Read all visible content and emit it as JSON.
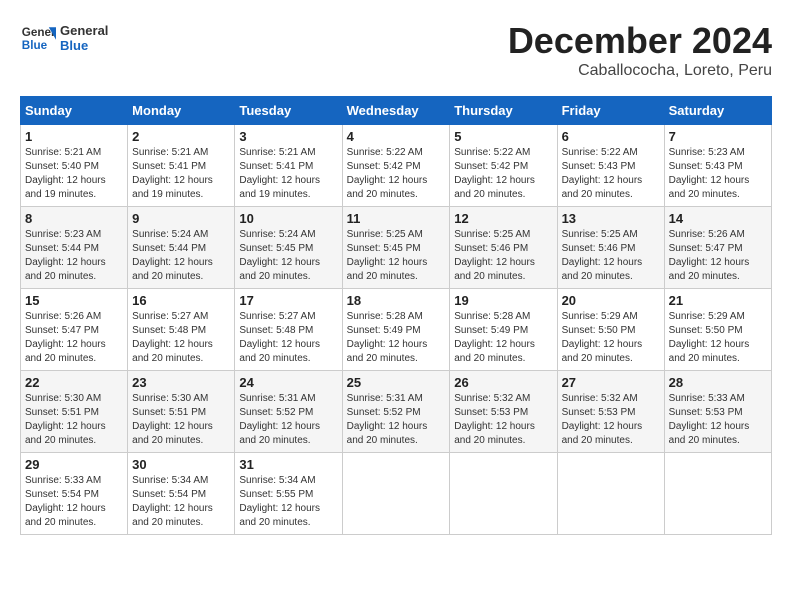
{
  "header": {
    "logo_general": "General",
    "logo_blue": "Blue",
    "month_title": "December 2024",
    "location": "Caballococha, Loreto, Peru"
  },
  "weekdays": [
    "Sunday",
    "Monday",
    "Tuesday",
    "Wednesday",
    "Thursday",
    "Friday",
    "Saturday"
  ],
  "weeks": [
    [
      {
        "day": "1",
        "info": "Sunrise: 5:21 AM\nSunset: 5:40 PM\nDaylight: 12 hours\nand 19 minutes."
      },
      {
        "day": "2",
        "info": "Sunrise: 5:21 AM\nSunset: 5:41 PM\nDaylight: 12 hours\nand 19 minutes."
      },
      {
        "day": "3",
        "info": "Sunrise: 5:21 AM\nSunset: 5:41 PM\nDaylight: 12 hours\nand 19 minutes."
      },
      {
        "day": "4",
        "info": "Sunrise: 5:22 AM\nSunset: 5:42 PM\nDaylight: 12 hours\nand 20 minutes."
      },
      {
        "day": "5",
        "info": "Sunrise: 5:22 AM\nSunset: 5:42 PM\nDaylight: 12 hours\nand 20 minutes."
      },
      {
        "day": "6",
        "info": "Sunrise: 5:22 AM\nSunset: 5:43 PM\nDaylight: 12 hours\nand 20 minutes."
      },
      {
        "day": "7",
        "info": "Sunrise: 5:23 AM\nSunset: 5:43 PM\nDaylight: 12 hours\nand 20 minutes."
      }
    ],
    [
      {
        "day": "8",
        "info": "Sunrise: 5:23 AM\nSunset: 5:44 PM\nDaylight: 12 hours\nand 20 minutes."
      },
      {
        "day": "9",
        "info": "Sunrise: 5:24 AM\nSunset: 5:44 PM\nDaylight: 12 hours\nand 20 minutes."
      },
      {
        "day": "10",
        "info": "Sunrise: 5:24 AM\nSunset: 5:45 PM\nDaylight: 12 hours\nand 20 minutes."
      },
      {
        "day": "11",
        "info": "Sunrise: 5:25 AM\nSunset: 5:45 PM\nDaylight: 12 hours\nand 20 minutes."
      },
      {
        "day": "12",
        "info": "Sunrise: 5:25 AM\nSunset: 5:46 PM\nDaylight: 12 hours\nand 20 minutes."
      },
      {
        "day": "13",
        "info": "Sunrise: 5:25 AM\nSunset: 5:46 PM\nDaylight: 12 hours\nand 20 minutes."
      },
      {
        "day": "14",
        "info": "Sunrise: 5:26 AM\nSunset: 5:47 PM\nDaylight: 12 hours\nand 20 minutes."
      }
    ],
    [
      {
        "day": "15",
        "info": "Sunrise: 5:26 AM\nSunset: 5:47 PM\nDaylight: 12 hours\nand 20 minutes."
      },
      {
        "day": "16",
        "info": "Sunrise: 5:27 AM\nSunset: 5:48 PM\nDaylight: 12 hours\nand 20 minutes."
      },
      {
        "day": "17",
        "info": "Sunrise: 5:27 AM\nSunset: 5:48 PM\nDaylight: 12 hours\nand 20 minutes."
      },
      {
        "day": "18",
        "info": "Sunrise: 5:28 AM\nSunset: 5:49 PM\nDaylight: 12 hours\nand 20 minutes."
      },
      {
        "day": "19",
        "info": "Sunrise: 5:28 AM\nSunset: 5:49 PM\nDaylight: 12 hours\nand 20 minutes."
      },
      {
        "day": "20",
        "info": "Sunrise: 5:29 AM\nSunset: 5:50 PM\nDaylight: 12 hours\nand 20 minutes."
      },
      {
        "day": "21",
        "info": "Sunrise: 5:29 AM\nSunset: 5:50 PM\nDaylight: 12 hours\nand 20 minutes."
      }
    ],
    [
      {
        "day": "22",
        "info": "Sunrise: 5:30 AM\nSunset: 5:51 PM\nDaylight: 12 hours\nand 20 minutes."
      },
      {
        "day": "23",
        "info": "Sunrise: 5:30 AM\nSunset: 5:51 PM\nDaylight: 12 hours\nand 20 minutes."
      },
      {
        "day": "24",
        "info": "Sunrise: 5:31 AM\nSunset: 5:52 PM\nDaylight: 12 hours\nand 20 minutes."
      },
      {
        "day": "25",
        "info": "Sunrise: 5:31 AM\nSunset: 5:52 PM\nDaylight: 12 hours\nand 20 minutes."
      },
      {
        "day": "26",
        "info": "Sunrise: 5:32 AM\nSunset: 5:53 PM\nDaylight: 12 hours\nand 20 minutes."
      },
      {
        "day": "27",
        "info": "Sunrise: 5:32 AM\nSunset: 5:53 PM\nDaylight: 12 hours\nand 20 minutes."
      },
      {
        "day": "28",
        "info": "Sunrise: 5:33 AM\nSunset: 5:53 PM\nDaylight: 12 hours\nand 20 minutes."
      }
    ],
    [
      {
        "day": "29",
        "info": "Sunrise: 5:33 AM\nSunset: 5:54 PM\nDaylight: 12 hours\nand 20 minutes."
      },
      {
        "day": "30",
        "info": "Sunrise: 5:34 AM\nSunset: 5:54 PM\nDaylight: 12 hours\nand 20 minutes."
      },
      {
        "day": "31",
        "info": "Sunrise: 5:34 AM\nSunset: 5:55 PM\nDaylight: 12 hours\nand 20 minutes."
      },
      {
        "day": "",
        "info": ""
      },
      {
        "day": "",
        "info": ""
      },
      {
        "day": "",
        "info": ""
      },
      {
        "day": "",
        "info": ""
      }
    ]
  ]
}
